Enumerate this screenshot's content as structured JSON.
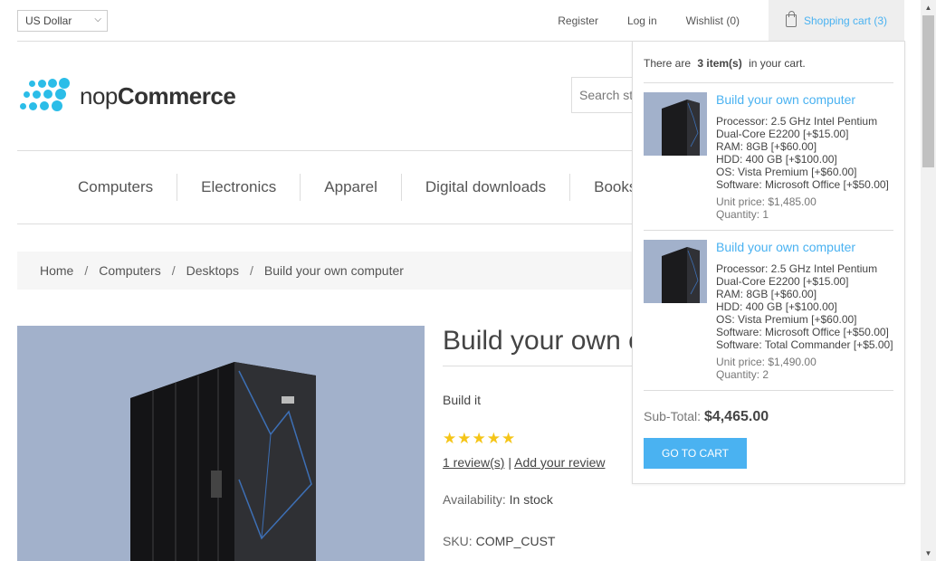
{
  "currency": {
    "selected": "US Dollar"
  },
  "header_links": {
    "register": "Register",
    "login": "Log in",
    "wishlist": "Wishlist (0)",
    "cart": "Shopping cart (3)"
  },
  "logo": {
    "light": "nop",
    "bold": "Commerce"
  },
  "search": {
    "placeholder": "Search store"
  },
  "menu": [
    "Computers",
    "Electronics",
    "Apparel",
    "Digital downloads",
    "Books"
  ],
  "breadcrumb": [
    "Home",
    "Computers",
    "Desktops",
    "Build your own computer"
  ],
  "breadcrumb_sep": "/",
  "product": {
    "title": "Build your own computer",
    "short_desc": "Build it",
    "rating_stars": 5,
    "reviews_link": "1 review(s)",
    "reviews_sep": "|",
    "add_review": "Add your review",
    "availability_label": "Availability:",
    "availability_value": "In stock",
    "sku_label": "SKU:",
    "sku_value": "COMP_CUST"
  },
  "flyout": {
    "count_prefix": "There are",
    "count": "3 item(s)",
    "count_suffix": "in your cart.",
    "items": [
      {
        "name": "Build your own computer",
        "attrs": [
          "Processor: 2.5 GHz Intel Pentium",
          "Dual-Core E2200 [+$15.00]",
          "RAM: 8GB [+$60.00]",
          "HDD: 400 GB [+$100.00]",
          "OS: Vista Premium [+$60.00]",
          "Software: Microsoft Office [+$50.00]"
        ],
        "unit_price": "Unit price: $1,485.00",
        "quantity": "Quantity: 1"
      },
      {
        "name": "Build your own computer",
        "attrs": [
          "Processor: 2.5 GHz Intel Pentium",
          "Dual-Core E2200 [+$15.00]",
          "RAM: 8GB [+$60.00]",
          "HDD: 400 GB [+$100.00]",
          "OS: Vista Premium [+$60.00]",
          "Software: Microsoft Office [+$50.00]",
          "Software: Total Commander [+$5.00]"
        ],
        "unit_price": "Unit price: $1,490.00",
        "quantity": "Quantity: 2"
      }
    ],
    "subtotal_label": "Sub-Total:",
    "subtotal_value": "$4,465.00",
    "go_to_cart": "GO TO CART"
  },
  "colors": {
    "accent": "#4ab2f1",
    "logo": "#2bbde8",
    "product_bg": "#a2b1cb"
  }
}
